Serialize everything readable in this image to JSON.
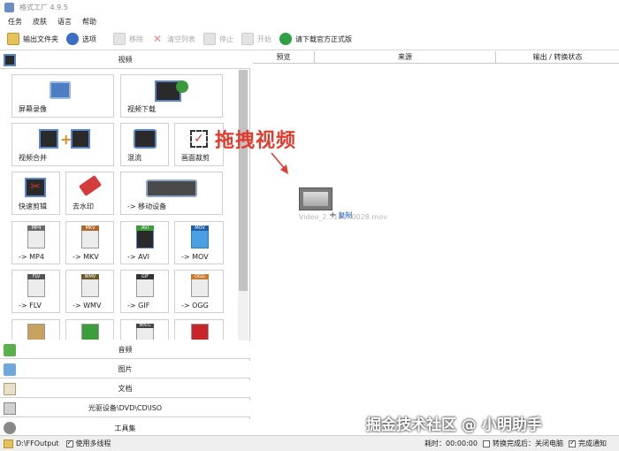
{
  "app": {
    "title": "格式工厂 4.9.5"
  },
  "menu": [
    "任务",
    "皮肤",
    "语言",
    "帮助"
  ],
  "toolbar": {
    "output_folder": "输出文件夹",
    "options": "选项",
    "remove": "移除",
    "clear_list": "清空列表",
    "stop": "停止",
    "start": "开始",
    "download_pro": "请下载官方正式版"
  },
  "left": {
    "video_header": "视频",
    "tiles": [
      "屏幕录像",
      "视频下载",
      "视频合并",
      "混流",
      "画面裁剪",
      "快速剪辑",
      "去水印",
      "-> 移动设备",
      "-> MP4",
      "-> MKV",
      "-> AVI",
      "-> MOV",
      "-> FLV",
      "-> WMV",
      "-> GIF",
      "-> OGG"
    ],
    "badges": [
      "MP4",
      "MKV",
      "AVI",
      "MOV",
      "FLV",
      "WMV",
      "GIF",
      "OGG",
      "MPEG"
    ],
    "sections": [
      "音频",
      "图片",
      "文档",
      "光驱设备\\DVD\\CD\\ISO",
      "工具集"
    ]
  },
  "right": {
    "columns": [
      "预览",
      "来源",
      "输出 / 转换状态"
    ],
    "drag_hint": "拖拽视频",
    "file_name": "Video_2...19170028.mov",
    "copy_label": "复制",
    "copy_plus": "+"
  },
  "status": {
    "output_path": "D:\\FFOutput",
    "multithread": "使用多线程",
    "elapsed": "耗时：00:00:00",
    "shutdown": "转换完成后：关闭电脑",
    "notify": "完成通知"
  },
  "watermark": "掘金技术社区 @ 小明助手",
  "colors": {
    "drag_red": "#e23c2e",
    "copy_blue": "#2a64c5",
    "green_pro": "#2ea043"
  }
}
